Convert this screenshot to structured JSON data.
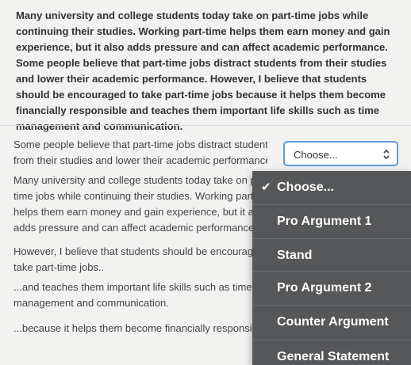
{
  "passage": "Many university and college students today take on part-time jobs while continuing their studies. Working part-time helps them earn money and gain experience, but it also adds pressure and can affect academic performance. Some people believe that part-time jobs distract students from their studies and lower their academic performance. However, I believe that students should be encouraged to take part-time jobs because it helps them become financially responsible and teaches them important life skills such as time management and communication.",
  "questions": {
    "q1_line1": "Some people believe that part-time jobs distract students",
    "q1_line2": "from their studies and lower their academic performance.",
    "q2_line1": "Many university and college students today take on part-",
    "q2_line2": "time jobs while continuing their studies. Working part-time",
    "q2_line3": "helps them earn money and gain experience, but it also",
    "q2_line4": "adds pressure and can affect academic performance.",
    "q3_line1": "However, I believe that students should be encouraged to",
    "q3_line2": "take part-time jobs..",
    "q4_line1": "...and teaches them important life skills such as time",
    "q4_line2": "management and communication.",
    "q5_line1": "...because it helps them become financially responsible."
  },
  "select": {
    "value": "Choose..."
  },
  "menu": {
    "items": [
      {
        "label": "Choose...",
        "checked": true
      },
      {
        "label": "Pro Argument 1"
      },
      {
        "label": "Stand"
      },
      {
        "label": "Pro Argument 2"
      },
      {
        "label": "Counter Argument"
      },
      {
        "label": "General Statement"
      }
    ]
  },
  "icons": {
    "check": "checkmark-icon",
    "select_arrows": "up-down-chevron-icon"
  },
  "colors": {
    "menu_bg": "#555759",
    "select_border": "#5b9dd9",
    "page_bg": "#f2f2f1"
  }
}
